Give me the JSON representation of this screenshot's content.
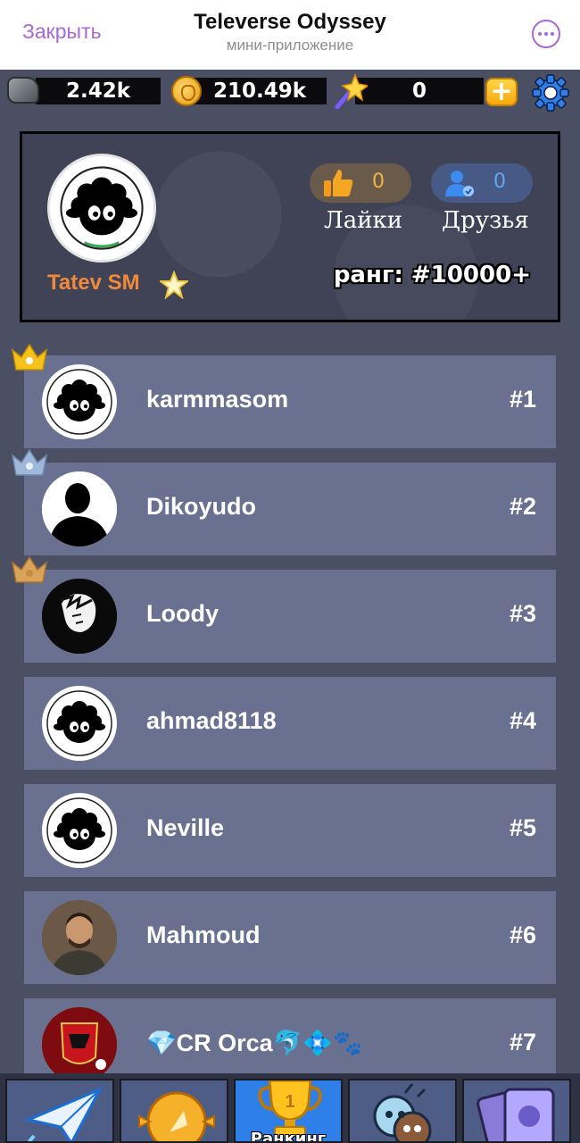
{
  "telegram": {
    "close_label": "Закрыть",
    "title": "Televerse Odyssey",
    "subtitle": "мини-приложение"
  },
  "resources": {
    "stone": "2.42k",
    "coins": "210.49k",
    "energy": "0"
  },
  "profile": {
    "name": "Tatev SM",
    "likes_count": "0",
    "friends_count": "0",
    "likes_label": "Лайки",
    "friends_label": "Друзья",
    "rank_text": "ранг: #10000+"
  },
  "leaderboard": [
    {
      "name": "karmmasom",
      "rank": "#1",
      "avatar": "sheep-avatar",
      "crown": "gold"
    },
    {
      "name": "Dikoyudo",
      "rank": "#2",
      "avatar": "silhouette-avatar",
      "crown": "silver"
    },
    {
      "name": "Loody",
      "rank": "#3",
      "avatar": "anime-avatar",
      "crown": "bronze"
    },
    {
      "name": "ahmad8118",
      "rank": "#4",
      "avatar": "sheep-avatar"
    },
    {
      "name": "Neville",
      "rank": "#5",
      "avatar": "sheep-avatar"
    },
    {
      "name": "Mahmoud",
      "rank": "#6",
      "avatar": "photo-avatar"
    },
    {
      "name": "💎CR Orca🐬💠🐾",
      "rank": "#7",
      "avatar": "club-logo-avatar"
    }
  ],
  "nav": {
    "ranking_label": "Ранкинг"
  },
  "colors": {
    "accent_purple": "#a867d6",
    "background": "#4b4f63",
    "row": "#6a708f",
    "profile_name": "#ef8a3b",
    "active_tab": "#2f7fe8"
  }
}
